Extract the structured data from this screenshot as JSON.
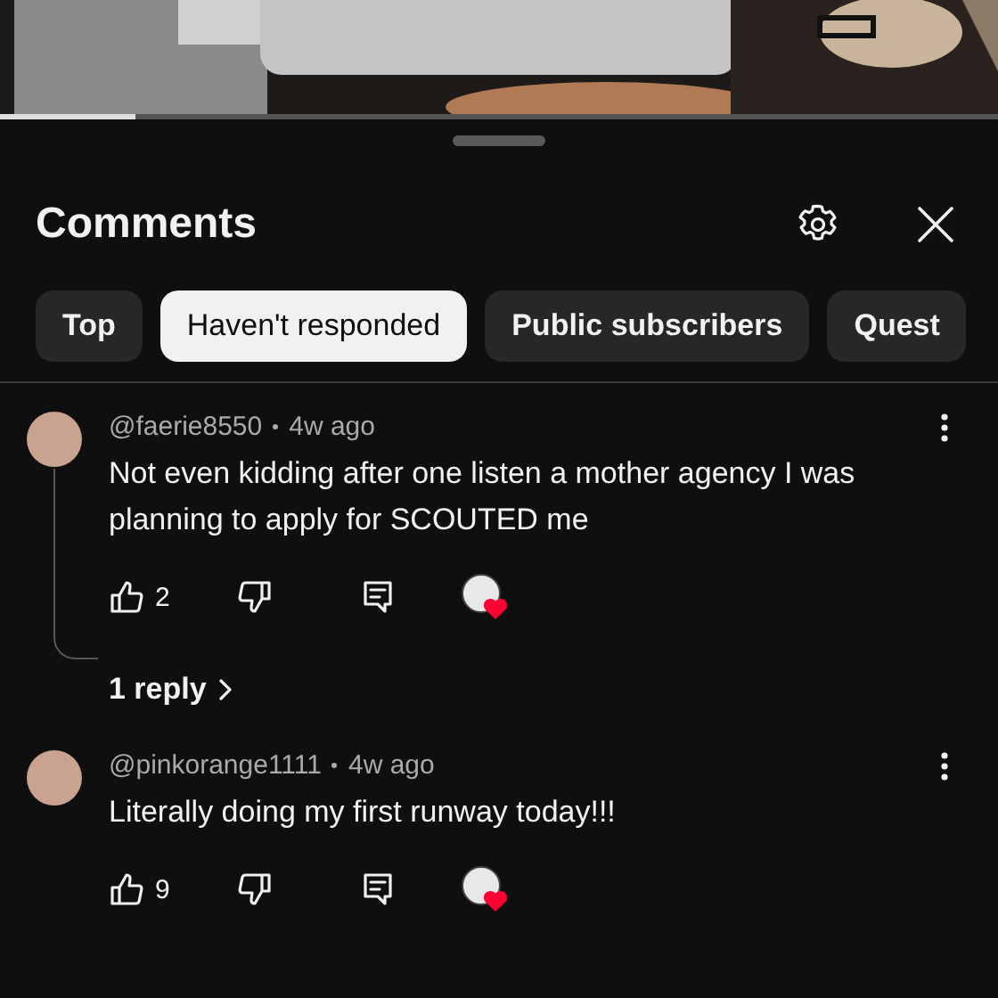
{
  "video": {
    "kind": "picture",
    "progress": {
      "level": 0.135
    }
  },
  "panel": {
    "title": "Comments"
  },
  "filters": [
    {
      "label": "Top",
      "selected": false
    },
    {
      "label": "Haven't responded",
      "selected": true
    },
    {
      "label": "Public subscribers",
      "selected": false
    },
    {
      "label": "Quest",
      "selected": false
    }
  ],
  "comments": [
    {
      "author": "@faerie8550",
      "time": "4w ago",
      "text": "Not even kidding after one listen a mother agency I was planning to apply for SCOUTED me",
      "likes": "2",
      "creator_hearted": true,
      "replies": "1 reply"
    },
    {
      "author": "@pinkorange1111",
      "time": "4w ago",
      "text": "Literally doing my first runway today!!!",
      "likes": "9",
      "creator_hearted": true
    }
  ]
}
